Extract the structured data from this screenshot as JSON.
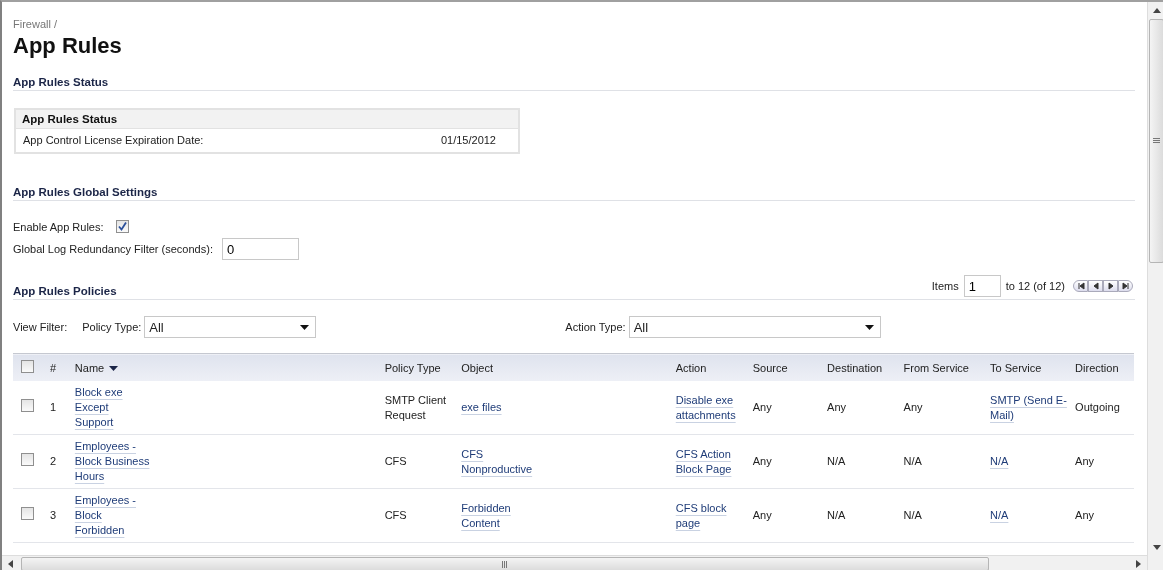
{
  "breadcrumb": "Firewall /",
  "title": "App Rules",
  "status_section": {
    "heading": "App Rules Status",
    "table_title": "App Rules Status",
    "rows": [
      {
        "label": "App Control License Expiration Date:",
        "value": "01/15/2012"
      }
    ]
  },
  "global_settings": {
    "heading": "App Rules Global Settings",
    "enable": {
      "label": "Enable App Rules:",
      "checked": true
    },
    "log_filter": {
      "label": "Global Log Redundancy Filter (seconds):",
      "value": "0"
    }
  },
  "policies": {
    "heading": "App Rules Policies",
    "pager": {
      "label": "Items",
      "value": "1",
      "range": "to 12 (of 12)"
    },
    "view_filter_label": "View Filter:",
    "filters": [
      {
        "label": "Policy Type:",
        "value": "All"
      },
      {
        "label": "Action Type:",
        "value": "All"
      }
    ],
    "table": {
      "select_all_checked": false,
      "columns": [
        {
          "kind": "text",
          "label": "#",
          "sorted": false
        },
        {
          "kind": "link",
          "label": "Name",
          "sorted": true
        },
        {
          "kind": "text",
          "label": "Policy Type",
          "sorted": false
        },
        {
          "kind": "link",
          "label": "Object",
          "sorted": false
        },
        {
          "kind": "link",
          "label": "Action",
          "sorted": false
        },
        {
          "kind": "text",
          "label": "Source",
          "sorted": false
        },
        {
          "kind": "text",
          "label": "Destination",
          "sorted": false
        },
        {
          "kind": "text",
          "label": "From Service",
          "sorted": false
        },
        {
          "kind": "link",
          "label": "To Service",
          "sorted": false
        },
        {
          "kind": "text",
          "label": "Direction",
          "sorted": false
        }
      ],
      "rows": [
        {
          "checked": false,
          "cells": [
            "1",
            "Block exe Except Support",
            "SMTP Client Request",
            "exe files",
            "Disable exe attachments",
            "Any",
            "Any",
            "Any",
            "SMTP (Send E-Mail)",
            "Outgoing"
          ]
        },
        {
          "checked": false,
          "cells": [
            "2",
            "Employees - Block Business Hours",
            "CFS",
            "CFS Nonproductive",
            "CFS Action Block Page",
            "Any",
            "N/A",
            "N/A",
            "N/A",
            "Any"
          ]
        },
        {
          "checked": false,
          "cells": [
            "3",
            "Employees - Block Forbidden",
            "CFS",
            "Forbidden Content",
            "CFS block page",
            "Any",
            "N/A",
            "N/A",
            "N/A",
            "Any"
          ]
        }
      ]
    }
  }
}
